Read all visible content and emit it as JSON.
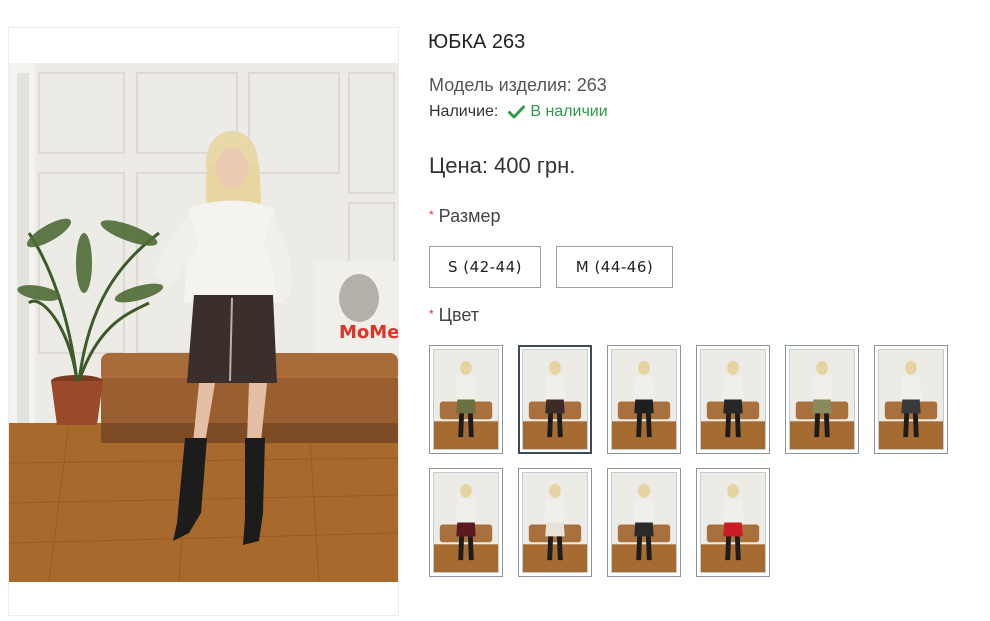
{
  "product": {
    "title": "ЮБКА 263",
    "model_label": "Модель изделия:",
    "model_value": "263",
    "stock_label": "Наличие:",
    "stock_value": "В наличии",
    "price_label": "Цена:",
    "price_value": "400 грн."
  },
  "options": {
    "required_mark": "*",
    "size_label": "Размер",
    "sizes": [
      "S (42-44)",
      "M (44-46)"
    ],
    "color_label": "Цвет",
    "colors": [
      {
        "name": "olive",
        "color": "#6b7040"
      },
      {
        "name": "brown-leather",
        "color": "#3b2c28",
        "selected": true
      },
      {
        "name": "black-leather",
        "color": "#1f1f1f"
      },
      {
        "name": "black-leather-2",
        "color": "#262626"
      },
      {
        "name": "khaki",
        "color": "#8a8a5c"
      },
      {
        "name": "graphite",
        "color": "#3a3a3a"
      },
      {
        "name": "burgundy",
        "color": "#5a1a22"
      },
      {
        "name": "white",
        "color": "#e8e2da"
      },
      {
        "name": "black-mirror",
        "color": "#2a2a2a"
      },
      {
        "name": "red",
        "color": "#c81e24"
      }
    ]
  },
  "theme": {
    "accent_green": "#2e9a4d",
    "required_red": "#e0333c"
  }
}
